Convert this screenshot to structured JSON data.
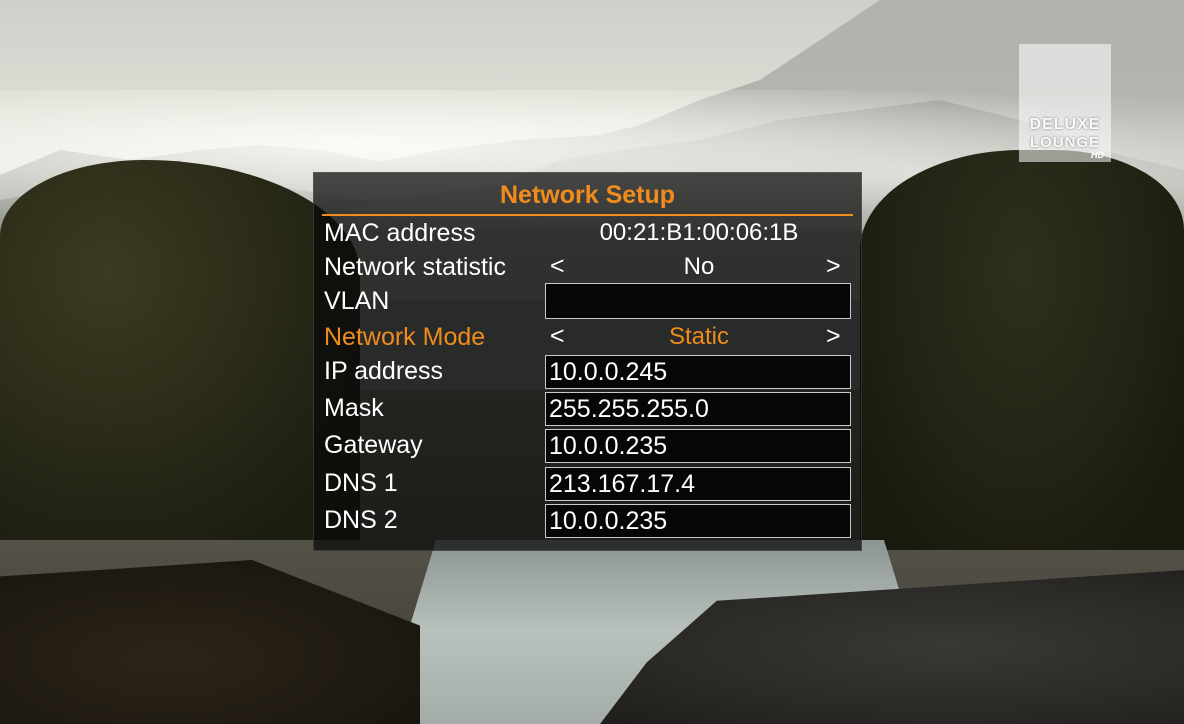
{
  "logo": {
    "line1": "DELUXE",
    "line2": "LOUNGE",
    "line3": "HD"
  },
  "panel": {
    "title": "Network Setup",
    "accent_color": "#f08c1c",
    "rows": [
      {
        "label": "MAC address",
        "value": "00:21:B1:00:06:1B",
        "kind": "readonly"
      },
      {
        "label": "Network statistic",
        "value": "No",
        "kind": "selector",
        "left_arrow": "<",
        "right_arrow": ">"
      },
      {
        "label": "VLAN",
        "value": "",
        "kind": "input"
      },
      {
        "label": "Network Mode",
        "value": "Static",
        "kind": "selector",
        "left_arrow": "<",
        "right_arrow": ">",
        "focused": true
      },
      {
        "label": "IP address",
        "value": "10.0.0.245",
        "kind": "input"
      },
      {
        "label": "Mask",
        "value": "255.255.255.0",
        "kind": "input"
      },
      {
        "label": "Gateway",
        "value": "10.0.0.235",
        "kind": "input"
      },
      {
        "label": "DNS 1",
        "value": "213.167.17.4",
        "kind": "input"
      },
      {
        "label": "DNS 2",
        "value": "10.0.0.235",
        "kind": "input"
      }
    ]
  }
}
